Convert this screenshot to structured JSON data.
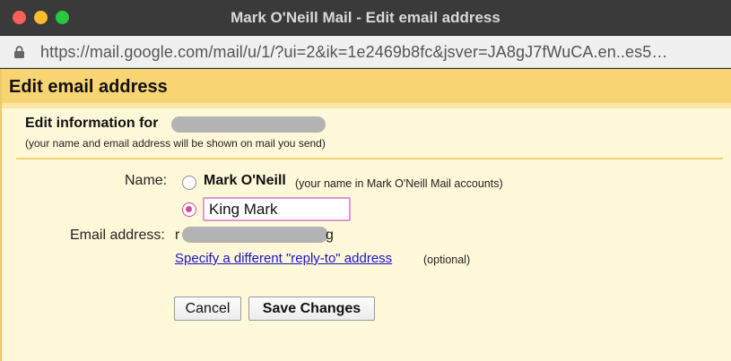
{
  "window": {
    "title": "Mark O'Neill Mail - Edit email address",
    "url": "https://mail.google.com/mail/u/1/?ui=2&ik=1e2469b8fc&jsver=JA8gJ7fWuCA.en..es5…"
  },
  "dialog": {
    "heading": "Edit email address",
    "edit_info_label": "Edit information for",
    "edit_info_subtitle": "(your name and email address will be shown on mail you send)",
    "name_label": "Name:",
    "name_option_1": {
      "name": "Mark O'Neill",
      "note": "(your name in Mark O'Neill Mail accounts)",
      "selected": false
    },
    "name_option_2": {
      "value": "King Mark",
      "selected": true
    },
    "email_label": "Email address:",
    "email_visible_start": "r",
    "email_visible_end": "g",
    "reply_to_link": "Specify a different \"reply-to\" address",
    "reply_to_optional": "(optional)",
    "cancel_button": "Cancel",
    "save_button": "Save Changes"
  },
  "colors": {
    "header_band": "#f8d473",
    "panel_background": "#fff8d9",
    "radio_accent": "#cf4da0",
    "link": "#1a13cc"
  }
}
